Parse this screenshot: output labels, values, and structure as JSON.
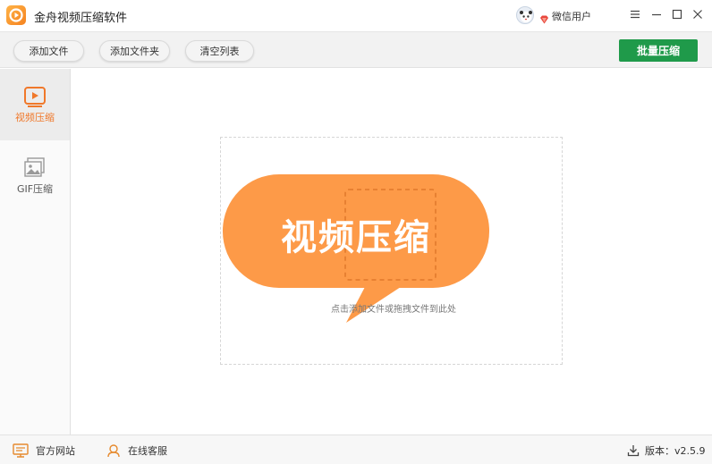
{
  "app": {
    "title": "金舟视频压缩软件",
    "user_name": "微信用户"
  },
  "toolbar": {
    "add_file": "添加文件",
    "add_folder": "添加文件夹",
    "clear_list": "清空列表",
    "batch_compress": "批量压缩"
  },
  "sidebar": {
    "items": [
      {
        "label": "视频压缩",
        "icon": "video-play-icon",
        "active": true
      },
      {
        "label": "GIF压缩",
        "icon": "image-icon",
        "active": false
      }
    ]
  },
  "main": {
    "banner_text": "视频压缩",
    "hint": "点击添加文件或拖拽文件到此处"
  },
  "statusbar": {
    "official_site": "官方网站",
    "online_service": "在线客服",
    "version_label": "版本：v2.5.9"
  },
  "colors": {
    "accent_orange": "#f0782a",
    "bubble_orange": "#fd9a48",
    "primary_green": "#1f9a4a"
  }
}
